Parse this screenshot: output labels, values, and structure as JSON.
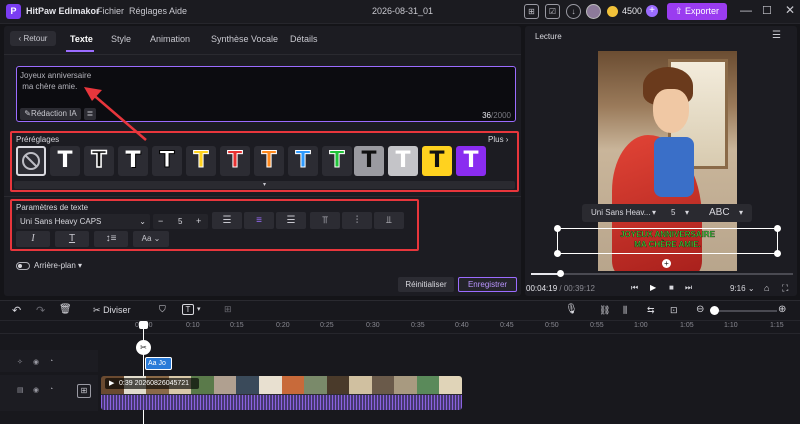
{
  "app": {
    "name": "HitPaw Edimakor",
    "menu": [
      "Fichier",
      "Réglages",
      "Aide"
    ],
    "project": "2026-08-31_01",
    "credits": "4500",
    "export_label": "Exporter"
  },
  "editor": {
    "back_label": "Retour",
    "tabs": [
      "Texte",
      "Style",
      "Animation",
      "Synthèse Vocale",
      "Détails"
    ],
    "active_tab": "Texte",
    "text_value": "Joyeux anniversaire\n ma chère amie.",
    "ai_label": "Rédaction IA",
    "char_count": "36",
    "char_max": "/2000",
    "presets_title": "Préréglages",
    "more_label": "Plus",
    "preset_glyph": "T",
    "params_title": "Paramètres de texte",
    "font_name": "Uni Sans Heavy CAPS",
    "font_size": "5",
    "case_label": "Aa",
    "background_label": "Arrière-plan",
    "reset_label": "Réinitialiser",
    "save_label": "Enregistrer"
  },
  "preview": {
    "title": "Lecture",
    "font_name": "Uni Sans Heav...",
    "font_size": "5",
    "style_label": "ABC",
    "caption_line1": "JOYEUX ANNIVERSAIRE",
    "caption_line2": "MA CHÈRE AMIE.",
    "time_current": "00:04:19",
    "time_total": "/ 00:39:12",
    "aspect": "9:16",
    "progress": 0.11
  },
  "timeline": {
    "split_label": "Diviser",
    "ticks": [
      "00:00",
      "0:10",
      "0:15",
      "0:20",
      "0:25",
      "0:30",
      "0:35",
      "0:40",
      "0:45",
      "0:50",
      "0:55",
      "1:00",
      "1:05",
      "1:10",
      "1:15"
    ],
    "text_clip_label": "Aa Jo",
    "video_clip_label": "0:39  20260826045721"
  },
  "colors": {
    "accent": "#9b6cff",
    "export": "#9a3cf0",
    "highlight": "#e8363c",
    "caption": "#3ddc3d"
  }
}
